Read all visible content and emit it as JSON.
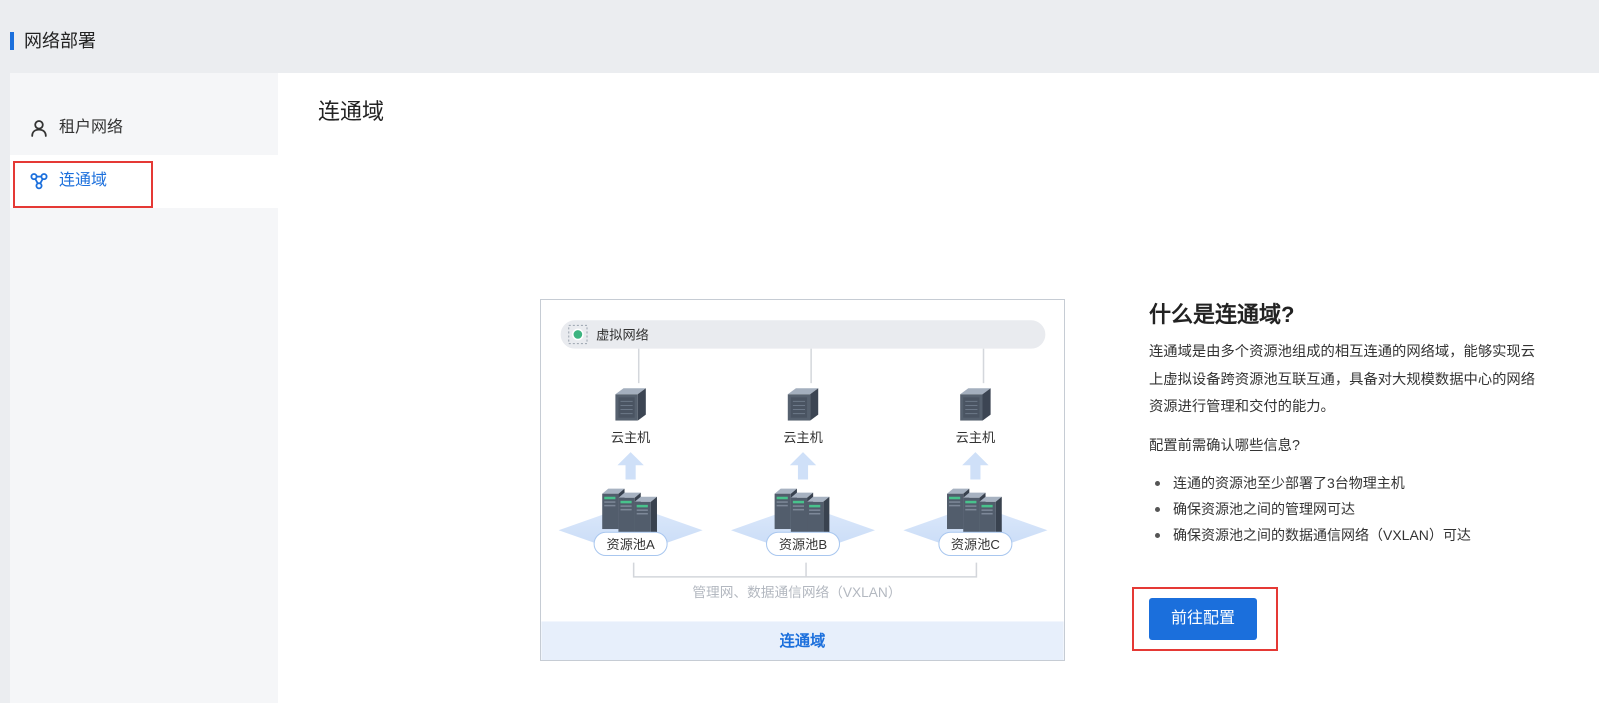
{
  "header": {
    "title": "网络部署"
  },
  "sidebar": {
    "items": [
      {
        "label": "租户网络",
        "icon": "user-icon",
        "active": false
      },
      {
        "label": "连通域",
        "icon": "network-icon",
        "active": true
      }
    ]
  },
  "main": {
    "title": "连通域",
    "diagram": {
      "virtual_network_label": "虚拟网络",
      "pools": [
        {
          "vm_label": "云主机",
          "pool_label": "资源池A"
        },
        {
          "vm_label": "云主机",
          "pool_label": "资源池B"
        },
        {
          "vm_label": "云主机",
          "pool_label": "资源池C"
        }
      ],
      "network_label": "管理网、数据通信网络（VXLAN）",
      "footer_label": "连通域"
    },
    "intro": {
      "heading": "什么是连通域?",
      "description": "连通域是由多个资源池组成的相互连通的网络域，能够实现云上虚拟设备跨资源池互联互通，具备对大规模数据中心的网络资源进行管理和交付的能力。",
      "checklist_heading": "配置前需确认哪些信息?",
      "checklist": [
        "连通的资源池至少部署了3台物理主机",
        "确保资源池之间的管理网可达",
        "确保资源池之间的数据通信网络（VXLAN）可达"
      ]
    },
    "actions": {
      "configure_label": "前往配置"
    }
  },
  "colors": {
    "accent": "#1b6fdc",
    "highlight": "#e53935",
    "header_bg": "#ebedf0",
    "sidebar_bg": "#f5f6f8"
  }
}
